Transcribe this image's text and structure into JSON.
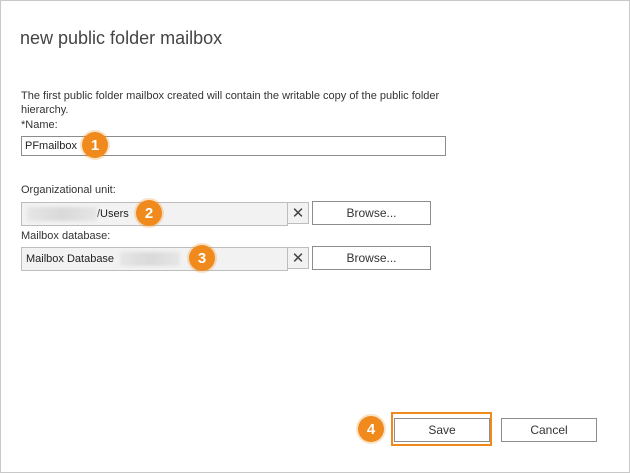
{
  "dialog": {
    "title": "new public folder mailbox",
    "description": "The first public folder mailbox created will contain the writable copy of the public folder hierarchy."
  },
  "name_field": {
    "label": "*Name:",
    "value": "PFmailbox"
  },
  "org_unit": {
    "label": "Organizational unit:",
    "value": "/Users",
    "clear_glyph": "✕",
    "browse_label": "Browse..."
  },
  "mailbox_db": {
    "label": "Mailbox database:",
    "value": "Mailbox Database",
    "clear_glyph": "✕",
    "browse_label": "Browse..."
  },
  "callouts": [
    "1",
    "2",
    "3",
    "4"
  ],
  "actions": {
    "save_label": "Save",
    "cancel_label": "Cancel"
  },
  "colors": {
    "callout": "#f08a1c",
    "border": "#8c8c8c",
    "readonly_bg": "#f2f2f2"
  }
}
